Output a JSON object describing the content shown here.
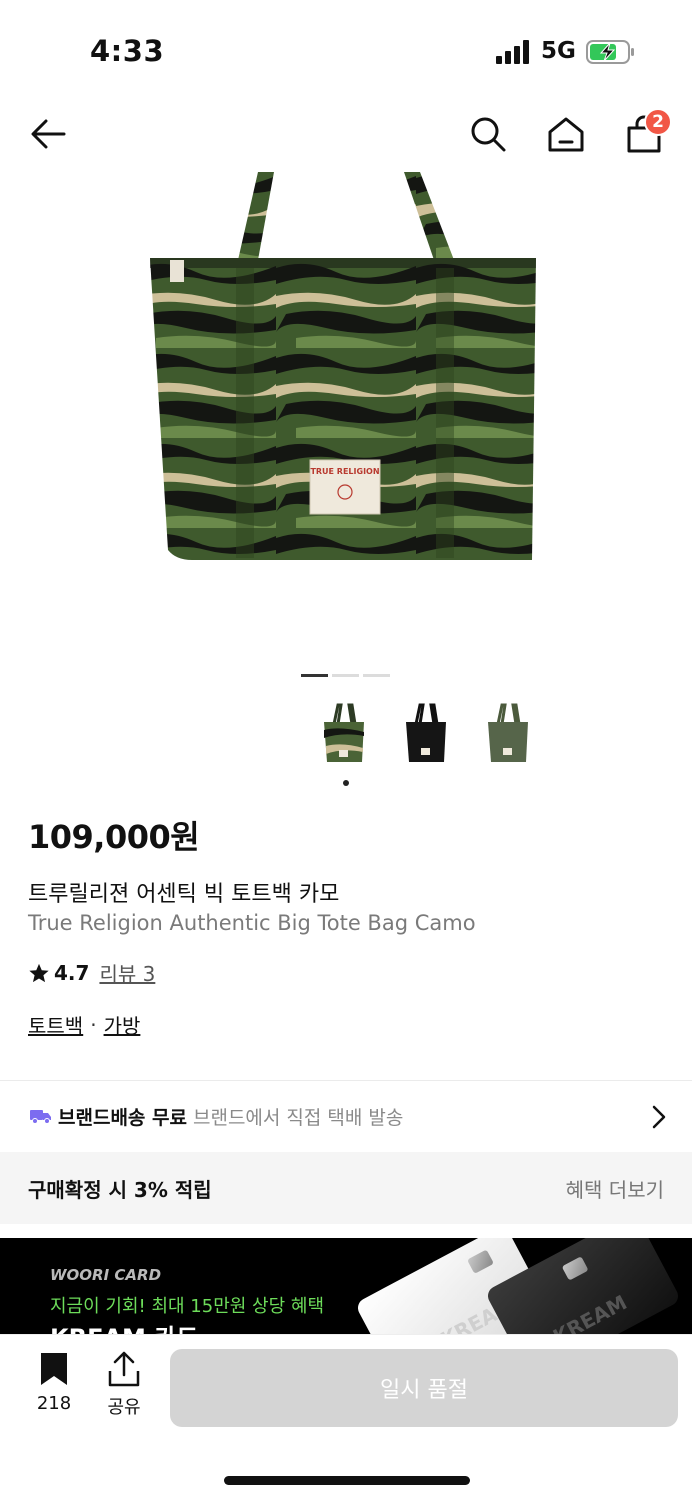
{
  "status_bar": {
    "time": "4:33",
    "network": "5G",
    "icons": [
      "signal-icon",
      "battery-charging-icon"
    ]
  },
  "nav": {
    "back_icon": "arrow-left-icon",
    "search_icon": "search-icon",
    "home_icon": "home-icon",
    "cart_icon": "shopping-bag-icon",
    "cart_count": "2"
  },
  "gallery": {
    "current_page": 1,
    "total_pages": 3,
    "thumbnails": [
      {
        "color": "camo",
        "selected": true
      },
      {
        "color": "black",
        "selected": false
      },
      {
        "color": "olive",
        "selected": false
      }
    ]
  },
  "product": {
    "price": "109,000원",
    "name_ko": "트루릴리젼 어센틱 빅 토트백 카모",
    "name_en": "True Religion Authentic Big Tote Bag Camo",
    "rating": "4.7",
    "review_link": "리뷰 3",
    "categories": [
      "토트백",
      "가방"
    ],
    "category_separator": "·",
    "patch_text": "TRUE RELIGION"
  },
  "shipping": {
    "title": "브랜드배송 무료",
    "desc": "브랜드에서 직접 택배 발송"
  },
  "benefit": {
    "text": "구매확정 시 3% 적립",
    "more": "혜택 더보기"
  },
  "banner": {
    "brand": "WOORI CARD",
    "promo": "지금이 기회! 최대 15만원 상당 혜택",
    "title": "KREAM 카드",
    "card_text": "KREAM"
  },
  "bottom": {
    "bookmark_count": "218",
    "share_label": "공유",
    "status_button": "일시 품절"
  },
  "colors": {
    "badge": "#f15746",
    "shipping_truck": "#7c6cf0",
    "banner_promo": "#6ddc5a",
    "soldout_button": "#d4d4d4"
  }
}
